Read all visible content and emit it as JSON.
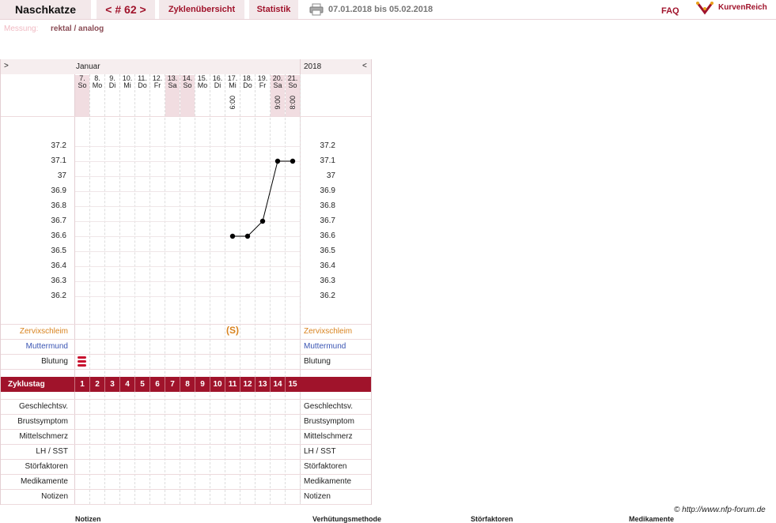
{
  "header": {
    "title": "Naschkatze",
    "cycle_nav": "< # 62 >",
    "tabs": [
      "Zyklenübersicht",
      "Statistik"
    ],
    "date_range": "07.01.2018 bis 05.02.2018",
    "faq": "FAQ",
    "brand": "KurvenReich"
  },
  "measurement": {
    "label": "Messung:",
    "value": "rektal / analog"
  },
  "chart": {
    "nav_left": ">",
    "nav_right": "<",
    "month": "Januar",
    "year": "2018",
    "days": [
      {
        "num": "7.",
        "wd": "So"
      },
      {
        "num": "8.",
        "wd": "Mo"
      },
      {
        "num": "9.",
        "wd": "Di"
      },
      {
        "num": "10.",
        "wd": "Mi"
      },
      {
        "num": "11.",
        "wd": "Do"
      },
      {
        "num": "12.",
        "wd": "Fr"
      },
      {
        "num": "13.",
        "wd": "Sa"
      },
      {
        "num": "14.",
        "wd": "So"
      },
      {
        "num": "15.",
        "wd": "Mo"
      },
      {
        "num": "16.",
        "wd": "Di"
      },
      {
        "num": "17.",
        "wd": "Mi"
      },
      {
        "num": "18.",
        "wd": "Do"
      },
      {
        "num": "19.",
        "wd": "Fr"
      },
      {
        "num": "20.",
        "wd": "Sa"
      },
      {
        "num": "21.",
        "wd": "So"
      }
    ],
    "times": {
      "10": "6:00",
      "13": "9:00",
      "14": "8:00"
    },
    "temp_ticks": [
      "37.2",
      "37.1",
      "37",
      "36.9",
      "36.8",
      "36.7",
      "36.6",
      "36.5",
      "36.4",
      "36.3",
      "36.2"
    ],
    "rows_top": {
      "zervix": "Zervixschleim",
      "muttermund": "Muttermund",
      "blutung": "Blutung"
    },
    "zervix_symbol": "S",
    "zyklustag_label": "Zyklustag",
    "zyklustage": [
      "1",
      "2",
      "3",
      "4",
      "5",
      "6",
      "7",
      "8",
      "9",
      "10",
      "11",
      "12",
      "13",
      "14",
      "15"
    ],
    "rows_bottom": [
      "Geschlechtsv.",
      "Brustsymptom",
      "Mittelschmerz",
      "LH / SST",
      "Störfaktoren",
      "Medikamente",
      "Notizen"
    ]
  },
  "chart_data": {
    "type": "line",
    "x": [
      "17.",
      "18.",
      "19.",
      "20.",
      "21."
    ],
    "values": [
      36.6,
      36.6,
      36.7,
      37.1,
      37.1
    ],
    "ylim": [
      36.2,
      37.2
    ]
  },
  "footer": {
    "copyright": "© http://www.nfp-forum.de",
    "bottom_labels": [
      "Notizen",
      "Verhütungsmethode",
      "Störfaktoren",
      "Medikamente"
    ]
  },
  "colors": {
    "accent": "#a0132b",
    "zervix": "#d9831f",
    "muttermund": "#3a55b3"
  }
}
